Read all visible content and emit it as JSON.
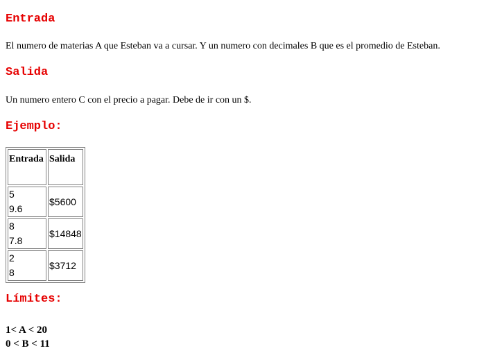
{
  "entrada": {
    "heading": "Entrada",
    "text": "El numero de materias A que Esteban va a cursar. Y un numero con decimales B que es el promedio de Esteban."
  },
  "salida": {
    "heading": "Salida",
    "text": "Un numero entero C con el precio a pagar. Debe de ir con un $."
  },
  "ejemplo": {
    "heading": "Ejemplo:",
    "columns": [
      "Entrada",
      "Salida"
    ],
    "rows": [
      {
        "input": [
          "5",
          "9.6"
        ],
        "output": "$5600"
      },
      {
        "input": [
          "8",
          "7.8"
        ],
        "output": "$14848"
      },
      {
        "input": [
          "2",
          "8"
        ],
        "output": "$3712"
      }
    ]
  },
  "limites": {
    "heading": "Límites:",
    "lines": [
      "1< A < 20",
      "0 < B < 11"
    ]
  }
}
